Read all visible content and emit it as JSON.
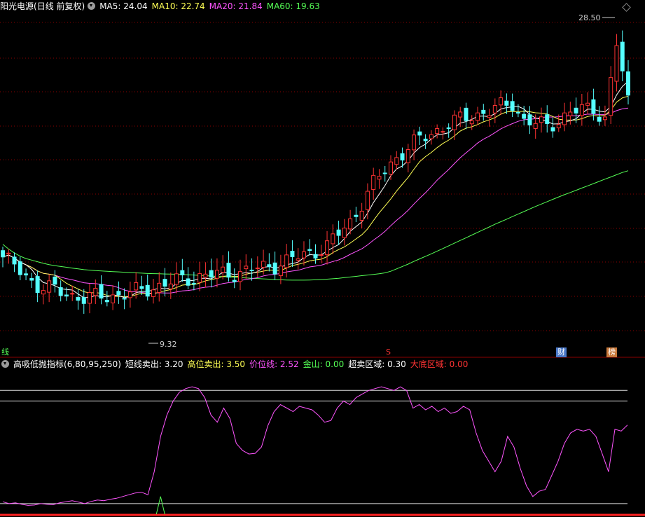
{
  "header": {
    "stock_name": "阳光电源",
    "period": "(日线 前复权)",
    "ma": [
      {
        "label": "MA5:",
        "value": "24.04",
        "color": "#ffffff"
      },
      {
        "label": "MA10:",
        "value": "22.74",
        "color": "#ffff55"
      },
      {
        "label": "MA20:",
        "value": "21.84",
        "color": "#ff55ff"
      },
      {
        "label": "MA60:",
        "value": "19.63",
        "color": "#55ff55"
      }
    ]
  },
  "indicator": {
    "name": "高吸低抛指标",
    "params": "(6,80,95,250)",
    "items": [
      {
        "label": "短线卖出:",
        "value": "3.20",
        "color": "#ffffff"
      },
      {
        "label": "高位卖出:",
        "value": "3.50",
        "color": "#ffff55"
      },
      {
        "label": "价位线:",
        "value": "2.52",
        "color": "#ff55ff"
      },
      {
        "label": "金山:",
        "value": "0.00",
        "color": "#55ff55"
      },
      {
        "label": "超卖区域:",
        "value": "0.30",
        "color": "#ffffff"
      },
      {
        "label": "大底区域:",
        "value": "0.00",
        "color": "#ff3333"
      }
    ]
  },
  "markers": {
    "high_label": "28.50",
    "low_label": "9.32",
    "tag_left": "线",
    "tag_s": "S",
    "tag_cai": "财",
    "tag_bang": "榜"
  },
  "colors": {
    "up": "#ff3333",
    "down": "#55ffff",
    "ma5": "#ffffff",
    "ma10": "#ffff55",
    "ma20": "#ff55ff",
    "ma60": "#55ff55",
    "grid": "#8b0000"
  },
  "chart_data": [
    {
      "type": "candlestick",
      "ylim": [
        8.5,
        29.5
      ],
      "ma60": [
        15.0,
        14.7,
        14.45,
        14.25,
        14.1,
        14.0,
        13.9,
        13.8,
        13.72,
        13.65,
        13.6,
        13.55,
        13.5,
        13.45,
        13.4,
        13.37,
        13.34,
        13.32,
        13.3,
        13.28,
        13.26,
        13.24,
        13.22,
        13.2,
        13.18,
        13.16,
        13.15,
        13.14,
        13.13,
        13.12,
        13.11,
        13.1,
        13.08,
        13.06,
        13.04,
        13.02,
        13.0,
        12.98,
        12.96,
        12.94,
        12.92,
        12.9,
        12.88,
        12.86,
        12.84,
        12.82,
        12.8,
        12.78,
        12.76,
        12.75,
        12.74,
        12.74,
        12.74,
        12.75,
        12.76,
        12.78,
        12.8,
        12.83,
        12.86,
        12.9,
        12.94,
        12.98,
        13.02,
        13.06,
        13.1,
        13.14,
        13.2,
        13.3,
        13.45,
        13.6,
        13.75,
        13.92,
        14.08,
        14.24,
        14.4,
        14.56,
        14.73,
        14.9,
        15.07,
        15.24,
        15.41,
        15.58,
        15.75,
        15.92,
        16.09,
        16.26,
        16.42,
        16.58,
        16.74,
        16.9,
        17.06,
        17.22,
        17.38,
        17.53,
        17.68,
        17.83,
        17.98,
        18.12,
        18.26,
        18.4,
        18.54,
        18.68,
        18.82,
        18.96,
        19.1,
        19.24,
        19.38,
        19.52,
        19.63
      ]
    },
    {
      "type": "line",
      "ylim": [
        0,
        4
      ],
      "hlines": [
        3.2,
        3.5,
        0.3
      ],
      "series": [
        {
          "name": "价位线",
          "values": [
            0.35,
            0.3,
            0.32,
            0.28,
            0.25,
            0.26,
            0.3,
            0.28,
            0.27,
            0.32,
            0.35,
            0.38,
            0.34,
            0.3,
            0.36,
            0.4,
            0.38,
            0.42,
            0.45,
            0.5,
            0.55,
            0.6,
            0.62,
            0.55,
            1.2,
            2.2,
            2.8,
            3.2,
            3.45,
            3.55,
            3.6,
            3.55,
            3.3,
            2.8,
            2.6,
            3.0,
            2.7,
            2.0,
            1.8,
            1.7,
            1.72,
            1.9,
            2.5,
            2.9,
            3.1,
            3.0,
            2.9,
            3.05,
            3.0,
            2.95,
            2.8,
            2.6,
            2.65,
            3.0,
            3.2,
            3.1,
            3.3,
            3.4,
            3.5,
            3.55,
            3.6,
            3.55,
            3.5,
            3.6,
            3.5,
            3.0,
            3.1,
            2.95,
            3.05,
            2.9,
            3.0,
            2.85,
            2.9,
            3.05,
            2.95,
            2.3,
            1.8,
            1.5,
            1.2,
            1.5,
            2.2,
            1.9,
            1.3,
            0.8,
            0.5,
            0.65,
            0.7,
            1.1,
            1.5,
            2.0,
            2.3,
            2.4,
            2.35,
            2.4,
            2.2,
            1.7,
            1.2,
            2.4,
            2.35,
            2.52
          ]
        }
      ],
      "signal_spike_index": 25
    }
  ]
}
